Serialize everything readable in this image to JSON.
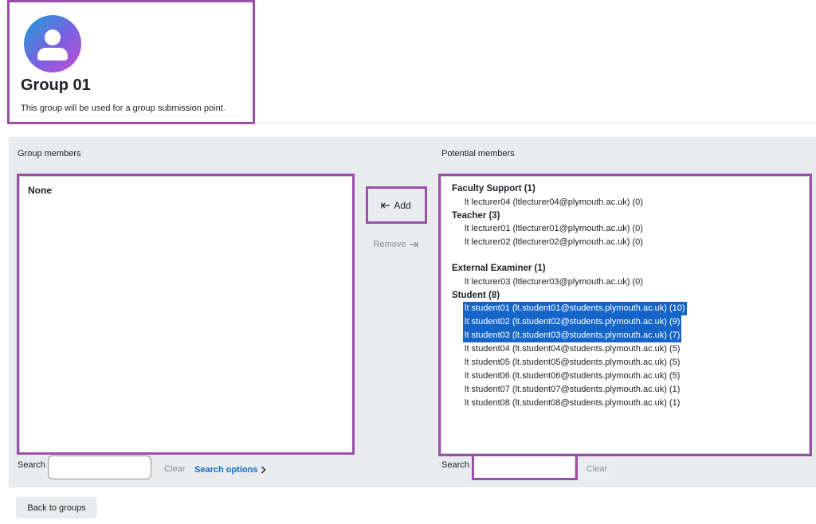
{
  "group": {
    "name": "Group 01",
    "description": "This group will be used for a group submission point."
  },
  "members": {
    "label": "Group members",
    "empty_text": "None",
    "search_label": "Search",
    "search_value": "",
    "clear_label": "Clear",
    "search_options_label": "Search options"
  },
  "actions": {
    "add_label": "Add",
    "add_icon": "arrow-left-to-bar",
    "remove_label": "Remove",
    "remove_icon": "arrow-right-to-bar"
  },
  "potential": {
    "label": "Potential members",
    "search_label": "Search",
    "search_value": "",
    "clear_label": "Clear",
    "groups": [
      {
        "label": "Faculty Support (1)",
        "options": [
          {
            "text": "lt lecturer04 (ltlecturer04@plymouth.ac.uk) (0)",
            "selected": false
          }
        ]
      },
      {
        "label": "Teacher (3)",
        "options": [
          {
            "text": "lt lecturer01 (ltlecturer01@plymouth.ac.uk) (0)",
            "selected": false
          },
          {
            "text": "lt lecturer02 (ltlecturer02@plymouth.ac.uk) (0)",
            "selected": false
          }
        ]
      },
      {
        "label": "External Examiner (1)",
        "options": [
          {
            "text": "lt lecturer03 (ltlecturer03@plymouth.ac.uk) (0)",
            "selected": false
          }
        ]
      },
      {
        "label": "Student (8)",
        "options": [
          {
            "text": "lt student01 (lt.student01@students.plymouth.ac.uk) (10)",
            "selected": true
          },
          {
            "text": "lt student02 (lt.student02@students.plymouth.ac.uk) (9)",
            "selected": true
          },
          {
            "text": "lt student03 (lt.student03@students.plymouth.ac.uk) (7)",
            "selected": true
          },
          {
            "text": "lt student04 (lt.student04@students.plymouth.ac.uk) (5)",
            "selected": false
          },
          {
            "text": "lt student05 (lt.student05@students.plymouth.ac.uk) (5)",
            "selected": false
          },
          {
            "text": "lt student06 (lt.student06@students.plymouth.ac.uk) (5)",
            "selected": false
          },
          {
            "text": "lt student07 (lt.student07@students.plymouth.ac.uk) (1)",
            "selected": false
          },
          {
            "text": "lt student08 (lt.student08@students.plymouth.ac.uk) (1)",
            "selected": false
          }
        ]
      }
    ]
  },
  "footer": {
    "back_label": "Back to groups"
  },
  "colors": {
    "highlight": "#9b4fa8",
    "selection": "#1565c9",
    "link": "#0f6cbf",
    "panel": "#e9ecef"
  }
}
